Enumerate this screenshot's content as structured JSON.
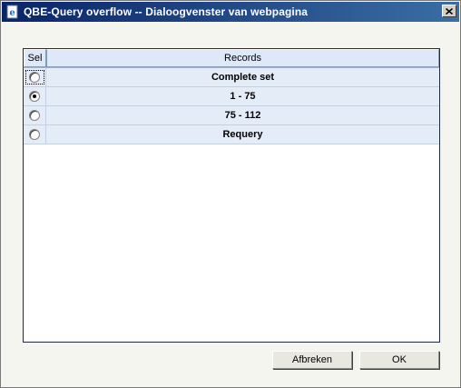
{
  "window": {
    "title": "QBE-Query overflow -- Dialoogvenster van webpagina",
    "icon": "ie-page-icon",
    "close_icon": "close-icon"
  },
  "grid": {
    "columns": [
      "Sel",
      "Records"
    ],
    "rows": [
      {
        "label": "Complete set",
        "selected": false
      },
      {
        "label": "1 - 75",
        "selected": true
      },
      {
        "label": "75 - 112",
        "selected": false
      },
      {
        "label": "Requery",
        "selected": false
      }
    ]
  },
  "buttons": {
    "cancel_label": "Afbreken",
    "ok_label": "OK"
  },
  "colors": {
    "titlebar_start": "#0a246a",
    "titlebar_end": "#3a6ea5",
    "row_background": "#e4ecf8",
    "header_background": "#dde8f8"
  }
}
